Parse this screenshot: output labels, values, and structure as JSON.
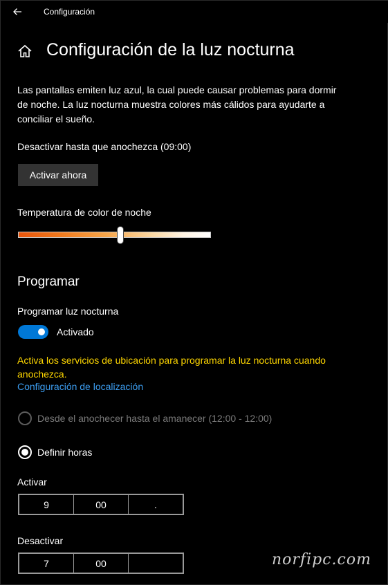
{
  "window": {
    "title": "Configuración"
  },
  "page": {
    "title": "Configuración de la luz nocturna",
    "description": "Las pantallas emiten luz azul, la cual puede causar problemas para dormir de noche. La luz nocturna muestra colores más cálidos para ayudarte a conciliar el sueño.",
    "status": "Desactivar hasta que anochezca (09:00)",
    "activate_button": "Activar ahora"
  },
  "temperature": {
    "label": "Temperatura de color de noche",
    "value_fraction": 0.53
  },
  "schedule": {
    "section_title": "Programar",
    "toggle_label": "Programar luz nocturna",
    "toggle_state": "Activado",
    "toggle_on": true,
    "warning": "Activa los servicios de ubicación para programar la luz nocturna cuando anochezca.",
    "location_link": "Configuración de localización",
    "options": [
      {
        "label": "Desde el anochecer hasta el amanecer (12:00 - 12:00)",
        "selected": false,
        "enabled": false
      },
      {
        "label": "Definir horas",
        "selected": true,
        "enabled": true
      }
    ],
    "on_time": {
      "label": "Activar",
      "hour": "9",
      "minute": "00",
      "period": "."
    },
    "off_time": {
      "label": "Desactivar",
      "hour": "7",
      "minute": "00",
      "period": ""
    }
  },
  "watermark": "norfipc.com",
  "colors": {
    "background": "#000000",
    "accent": "#0078d7",
    "warning": "#ffd700",
    "link": "#3c9df0"
  },
  "icons": {
    "back": "back-arrow-icon",
    "home": "home-icon"
  }
}
